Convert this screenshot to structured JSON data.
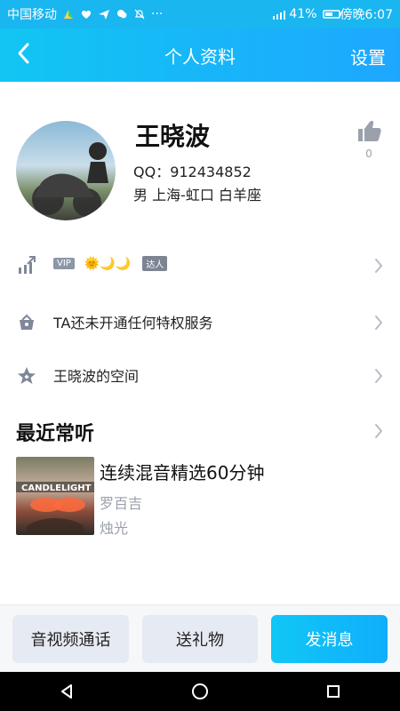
{
  "status_bar": {
    "carrier": "中国移动",
    "dots": "···",
    "battery": "41%",
    "time": "傍晚6:07",
    "icons": [
      "carrier-color-icon",
      "heart-icon",
      "send-icon",
      "chat-icon",
      "bell-off-icon",
      "signal-icon",
      "battery-icon"
    ]
  },
  "titlebar": {
    "title": "个人资料",
    "settings": "设置",
    "back_icon": "chevron-left-icon"
  },
  "profile": {
    "name": "王晓波",
    "qq_line": "QQ：912434852",
    "info_line": "男  上海-虹口  白羊座",
    "like_count": "0",
    "like_icon": "thumbs-up-icon"
  },
  "rows": [
    {
      "id": "vip",
      "icon": "level-up-icon",
      "vip_badge": "VIP",
      "vip_icons": "🌞🌙🌙",
      "talent_badge": "达人",
      "chevron": "chevron-right-icon"
    },
    {
      "id": "privileges",
      "icon": "crown-bag-icon",
      "label": "TA还未开通任何特权服务",
      "chevron": "chevron-right-icon"
    },
    {
      "id": "space",
      "icon": "star-icon",
      "label": "王晓波的空间",
      "chevron": "chevron-right-icon"
    }
  ],
  "recent": {
    "title": "最近常听",
    "chevron": "chevron-right-icon",
    "track": {
      "title": "连续混音精选60分钟",
      "artist": "罗百吉",
      "album": "烛光",
      "cover_text": "CANDLELIGHT"
    }
  },
  "bottom_actions": {
    "av_call": "音视频通话",
    "gift": "送礼物",
    "message": "发消息"
  },
  "navbar": {
    "back_icon": "nav-back-icon",
    "home_icon": "nav-home-icon",
    "recents_icon": "nav-recents-icon"
  }
}
